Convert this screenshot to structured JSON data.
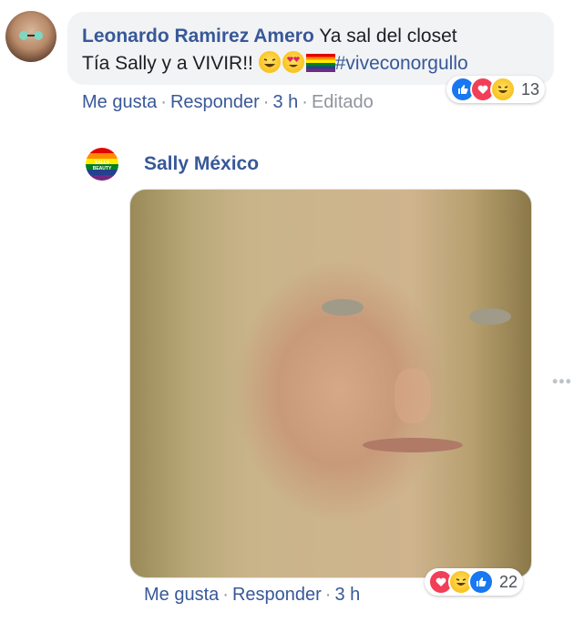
{
  "comment1": {
    "author": "Leonardo Ramirez Amero",
    "text_line1": "Ya sal del closet",
    "text_line2": "Tía Sally y a VIVIR!!",
    "hashtag": "#viveconorgullo",
    "actions": {
      "like": "Me gusta",
      "reply": "Responder",
      "time": "3 h",
      "edited": "Editado"
    },
    "reactions": {
      "icons": [
        "like-icon",
        "love-icon",
        "haha-icon"
      ],
      "count": "13"
    }
  },
  "reply": {
    "author": "Sally México",
    "avatar_text": "SALLY BEAUTY",
    "gif_alt": "",
    "actions": {
      "like": "Me gusta",
      "reply": "Responder",
      "time": "3 h"
    },
    "reactions": {
      "icons": [
        "love-icon",
        "haha-icon",
        "like-icon"
      ],
      "count": "22"
    }
  },
  "colors": {
    "link": "#385898",
    "bubble": "#f2f3f5",
    "like": "#1877f2",
    "love": "#f33e58"
  }
}
